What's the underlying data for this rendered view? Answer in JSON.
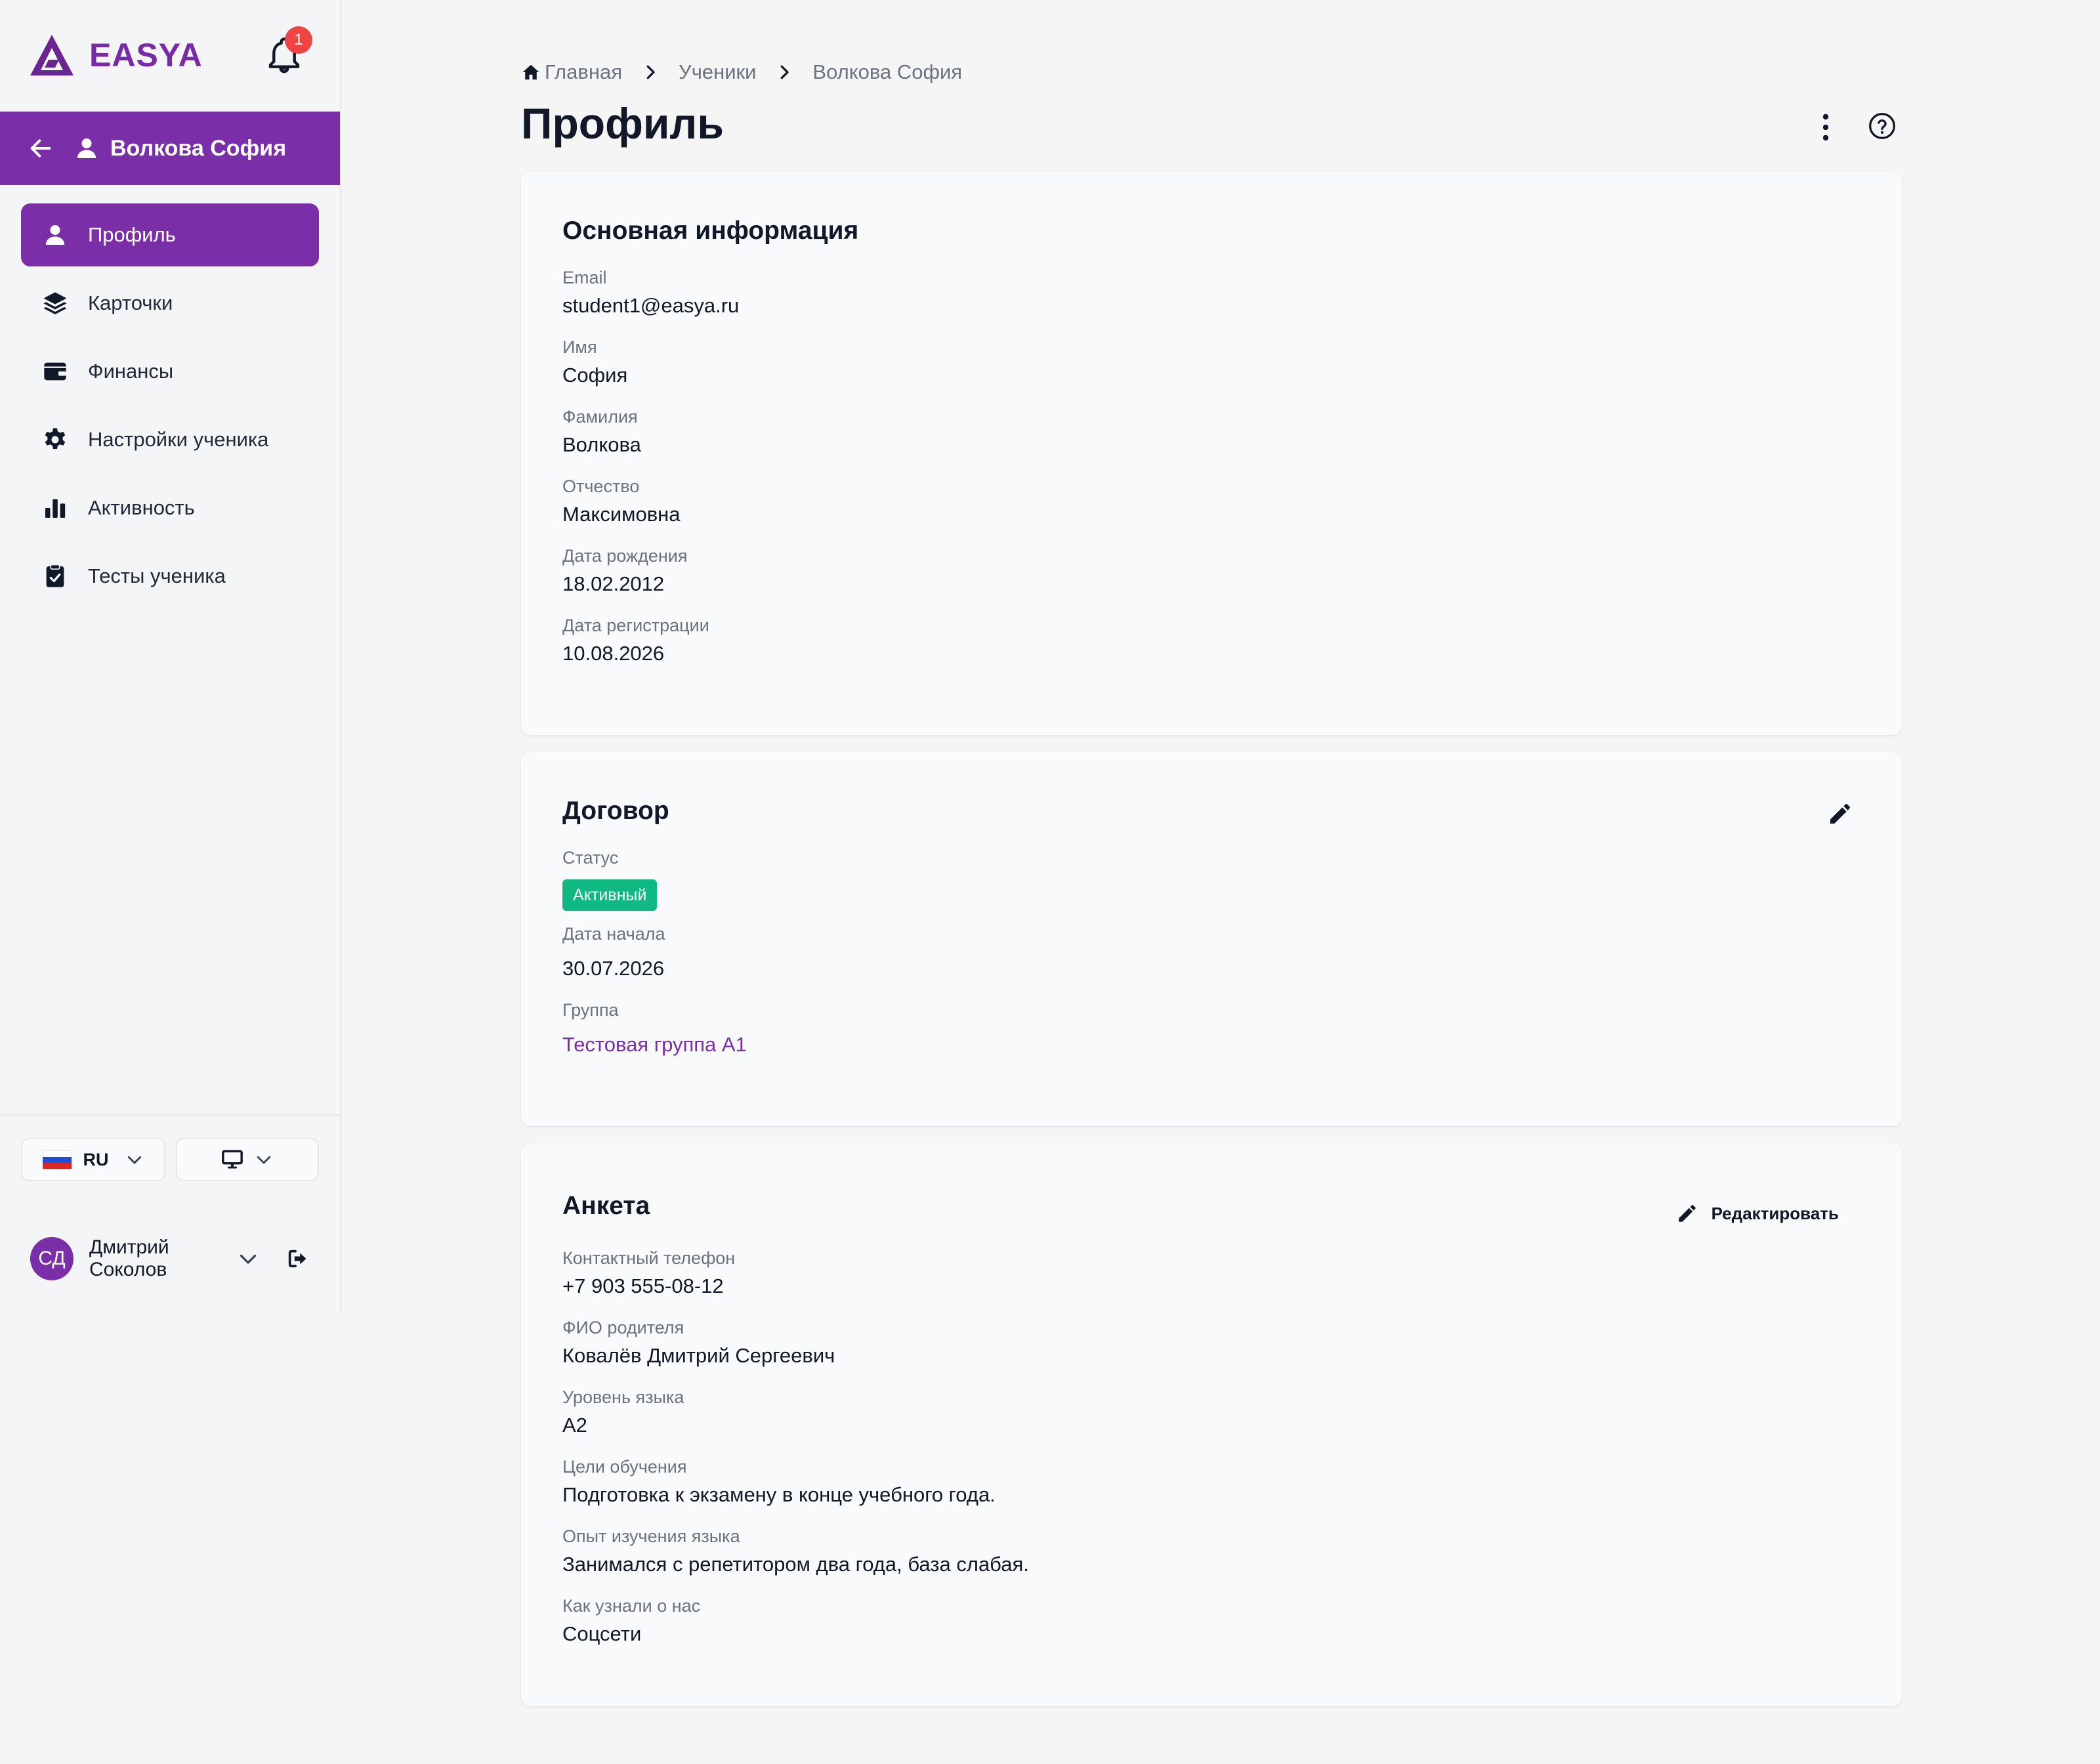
{
  "app": {
    "brand": "EASYA",
    "notifications_count": "1"
  },
  "student_header": {
    "name": "Волкова София"
  },
  "sidebar": {
    "items": [
      {
        "label": "Профиль",
        "icon": "user-icon",
        "active": true
      },
      {
        "label": "Карточки",
        "icon": "layers-icon",
        "active": false
      },
      {
        "label": "Финансы",
        "icon": "wallet-icon",
        "active": false
      },
      {
        "label": "Настройки ученика",
        "icon": "gear-icon",
        "active": false
      },
      {
        "label": "Активность",
        "icon": "bar-chart-icon",
        "active": false
      },
      {
        "label": "Тесты ученика",
        "icon": "clipboard-check-icon",
        "active": false
      }
    ],
    "language": {
      "code": "RU"
    },
    "user": {
      "initials": "СД",
      "name": "Дмитрий Соколов"
    }
  },
  "breadcrumb": {
    "home": "Главная",
    "students": "Ученики",
    "current": "Волкова София"
  },
  "page": {
    "title": "Профиль"
  },
  "basic_info": {
    "title": "Основная информация",
    "fields": [
      {
        "label": "Email",
        "value": "student1@easya.ru"
      },
      {
        "label": "Имя",
        "value": "София"
      },
      {
        "label": "Фамилия",
        "value": "Волкова"
      },
      {
        "label": "Отчество",
        "value": "Максимовна"
      },
      {
        "label": "Дата рождения",
        "value": "18.02.2012"
      },
      {
        "label": "Дата регистрации",
        "value": "10.08.2026"
      }
    ]
  },
  "contract": {
    "title": "Договор",
    "status_label": "Статус",
    "status_value": "Активный",
    "start_label": "Дата начала",
    "start_value": "30.07.2026",
    "group_label": "Группа",
    "group_value": "Тестовая группа А1"
  },
  "questionnaire": {
    "title": "Анкета",
    "edit_label": "Редактировать",
    "fields": [
      {
        "label": "Контактный телефон",
        "value": "+7 903 555-08-12"
      },
      {
        "label": "ФИО родителя",
        "value": "Ковалёв Дмитрий Сергеевич"
      },
      {
        "label": "Уровень языка",
        "value": "A2"
      },
      {
        "label": "Цели обучения",
        "value": "Подготовка к экзамену в конце учебного года."
      },
      {
        "label": "Опыт изучения языка",
        "value": "Занимался с репетитором два года, база слабая."
      },
      {
        "label": "Как узнали о нас",
        "value": "Соцсети"
      }
    ]
  },
  "colors": {
    "accent": "#7a2fa9",
    "status_active": "#10b981",
    "notification": "#ef4444"
  }
}
